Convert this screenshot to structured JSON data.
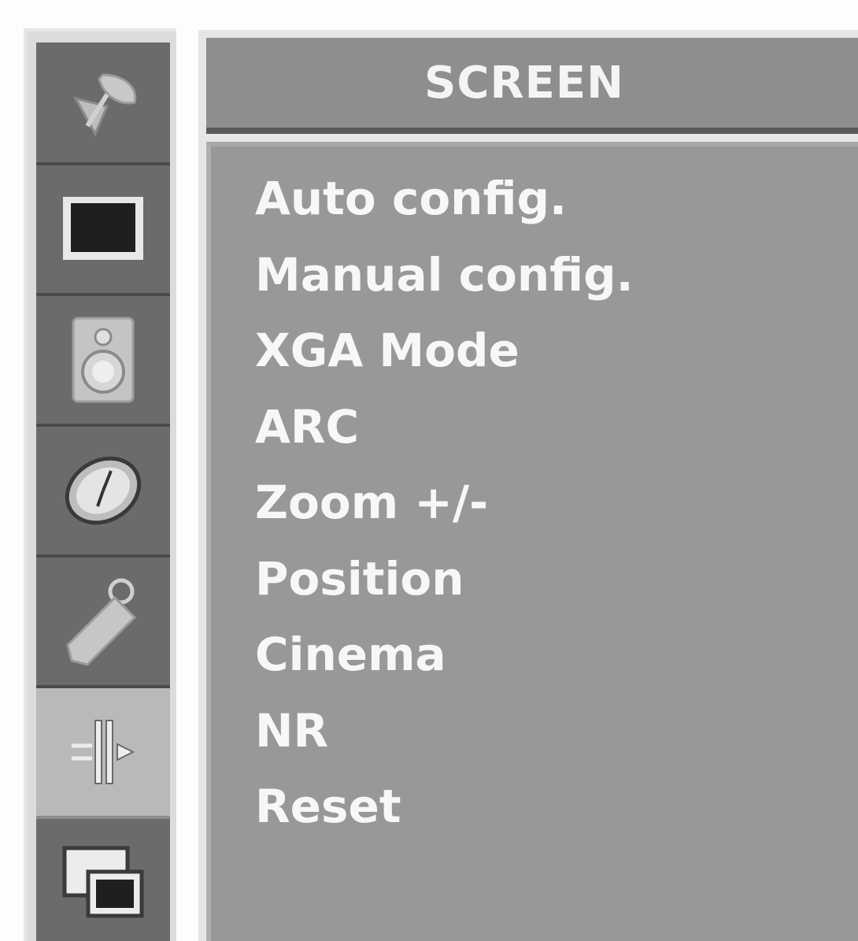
{
  "sidebar": {
    "items": [
      {
        "icon": "satellite-dish-icon",
        "selected": false
      },
      {
        "icon": "picture-icon",
        "selected": false
      },
      {
        "icon": "speaker-icon",
        "selected": false
      },
      {
        "icon": "clock-icon",
        "selected": false
      },
      {
        "icon": "key-tag-icon",
        "selected": false
      },
      {
        "icon": "screen-adjust-icon",
        "selected": true
      },
      {
        "icon": "pip-icon",
        "selected": false
      }
    ]
  },
  "menu": {
    "title": "SCREEN",
    "items": [
      "Auto config.",
      "Manual config.",
      "XGA Mode",
      "ARC",
      "Zoom +/-",
      "Position",
      "Cinema",
      "NR",
      "Reset"
    ]
  },
  "colors": {
    "sidebar_item": "#6b6b6b",
    "sidebar_selected": "#b9b9b9",
    "header": "#8e8e8e",
    "body": "#989898",
    "text": "#f7f7f7"
  }
}
